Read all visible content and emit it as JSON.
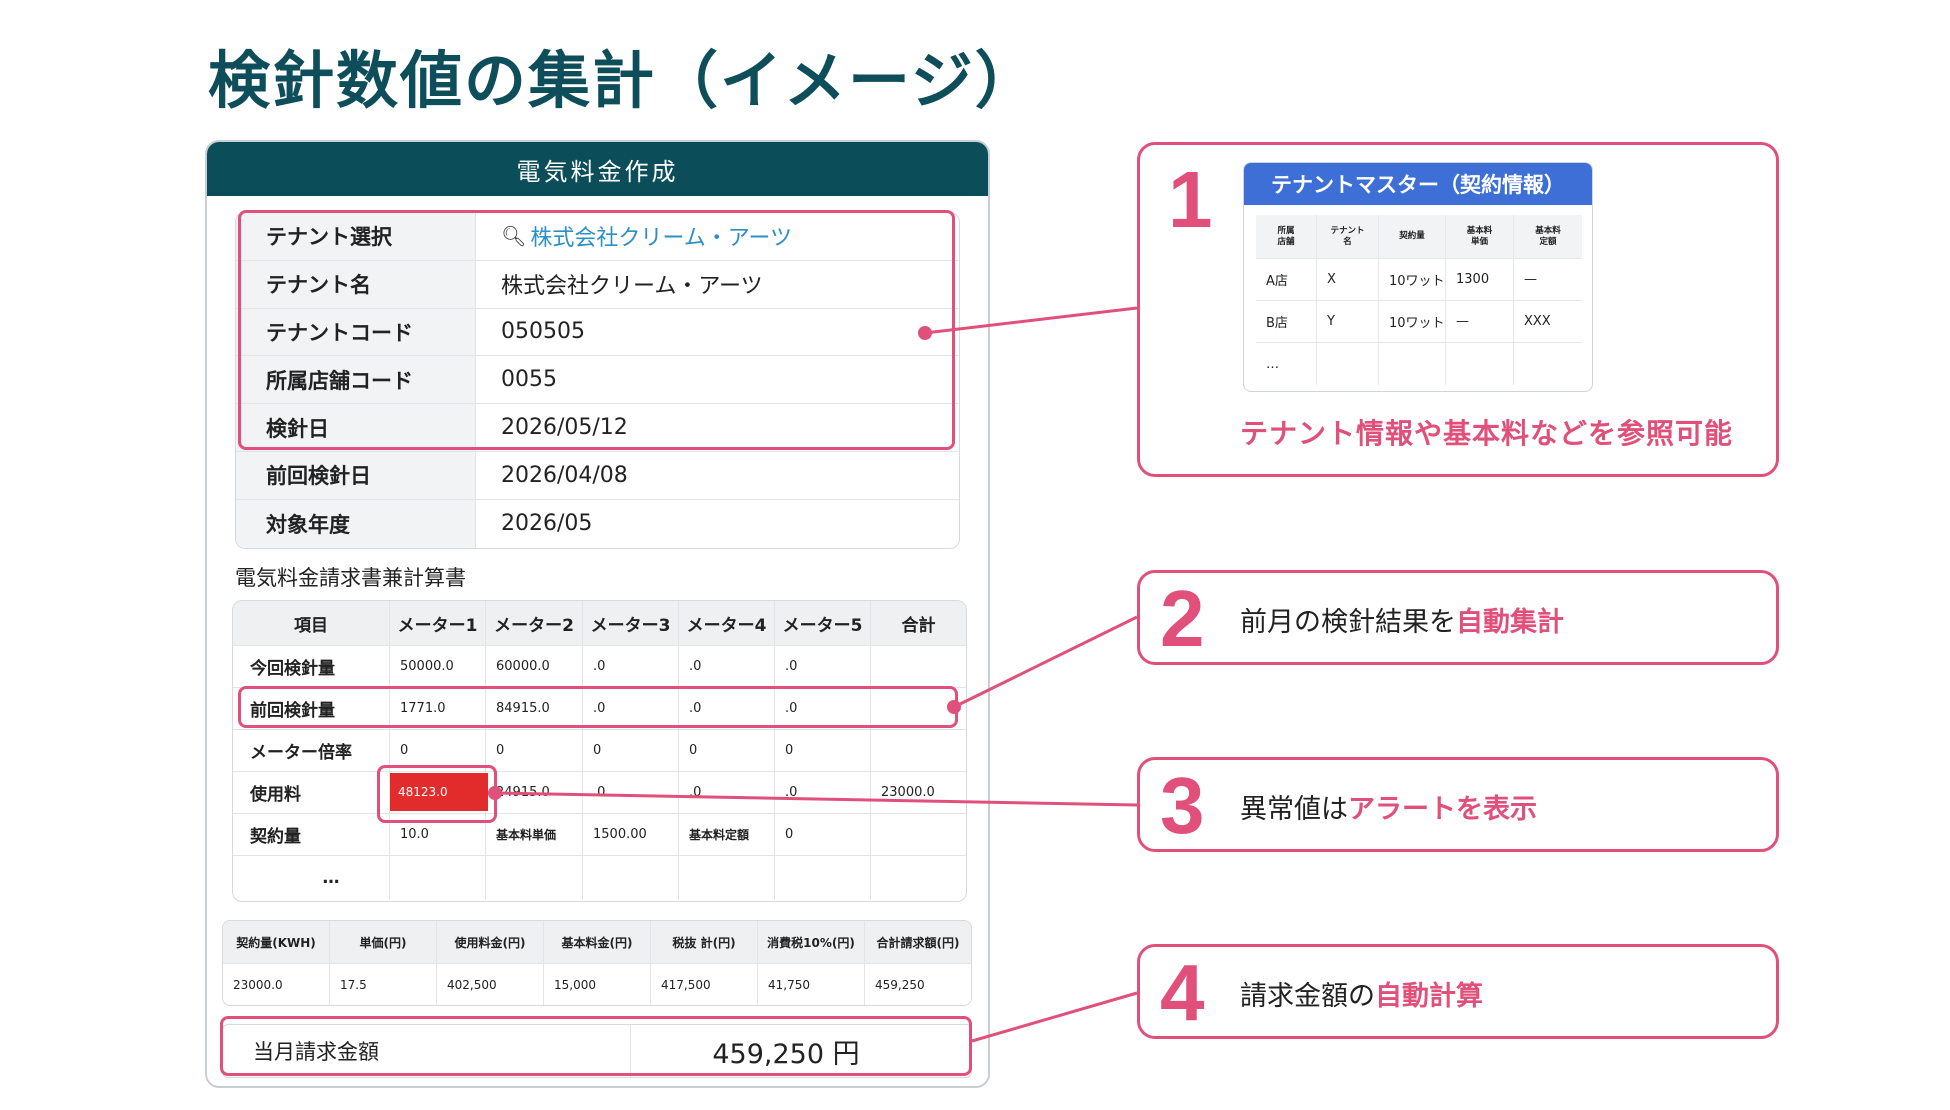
{
  "page": {
    "title": "検針数値の集計（イメージ）"
  },
  "panel": {
    "header": "電気料金作成",
    "info_rows": [
      {
        "label": "テナント選択",
        "value": "株式会社クリーム・アーツ"
      },
      {
        "label": "テナント名",
        "value": "株式会社クリーム・アーツ"
      },
      {
        "label": "テナントコード",
        "value": "050505"
      },
      {
        "label": "所属店舗コード",
        "value": "0055"
      },
      {
        "label": "検針日",
        "value": "2026/05/12"
      },
      {
        "label": "前回検針日",
        "value": "2026/04/08"
      },
      {
        "label": "対象年度",
        "value": "2026/05"
      }
    ],
    "section_title": "電気料金請求書兼計算書",
    "meter_table": {
      "headers": [
        "項目",
        "メーター1",
        "メーター2",
        "メーター3",
        "メーター4",
        "メーター5",
        "合計"
      ],
      "rows": [
        [
          "今回検針量",
          "50000.0",
          "60000.0",
          ".0",
          ".0",
          ".0",
          ""
        ],
        [
          "前回検針量",
          "1771.0",
          "84915.0",
          ".0",
          ".0",
          ".0",
          ""
        ],
        [
          "メーター倍率",
          "0",
          "0",
          "0",
          "0",
          "0",
          ""
        ],
        [
          "使用料",
          "48123.0",
          "24915.0",
          ".0",
          ".0",
          ".0",
          "23000.0"
        ],
        [
          "契約量",
          "10.0",
          "基本料単価",
          "1500.00",
          "基本料定額",
          "0",
          ""
        ],
        [
          "…",
          "",
          "",
          "",
          "",
          "",
          ""
        ]
      ]
    },
    "calc_table": {
      "headers": [
        "契約量(KWH)",
        "単価(円)",
        "使用料金(円)",
        "基本料金(円)",
        "税抜 計(円)",
        "消費税10%(円)",
        "合計請求額(円)"
      ],
      "values": [
        "23000.0",
        "17.5",
        "402,500",
        "15,000",
        "417,500",
        "41,750",
        "459,250"
      ]
    },
    "total": {
      "label": "当月請求金額",
      "value": "459,250 円"
    }
  },
  "callouts": [
    {
      "number": "1",
      "caption": "テナント情報や基本料などを参照可能"
    },
    {
      "number": "2",
      "text_plain": "前月の検針結果を",
      "text_emphasis": "自動集計"
    },
    {
      "number": "3",
      "text_plain": "異常値は",
      "text_emphasis": "アラートを表示"
    },
    {
      "number": "4",
      "text_plain": "請求金額の",
      "text_emphasis": "自動計算"
    }
  ],
  "tenant_master": {
    "title": "テナントマスター（契約情報）",
    "headers": [
      "所属\n店舗",
      "テナント\n名",
      "契約量",
      "基本料\n単価",
      "基本料\n定額"
    ],
    "rows": [
      [
        "A店",
        "X",
        "10ワット",
        "1300",
        "—"
      ],
      [
        "B店",
        "Y",
        "10ワット",
        "—",
        "XXX"
      ],
      [
        "…",
        "",
        "",
        "",
        ""
      ]
    ]
  },
  "colors": {
    "accent_pink": "#e0507a",
    "header_teal": "#0b4d59",
    "title_teal": "#0e4e5a",
    "master_blue": "#3e6fd6",
    "alert_red": "#e22b2b",
    "link_blue": "#2c8fc6"
  }
}
